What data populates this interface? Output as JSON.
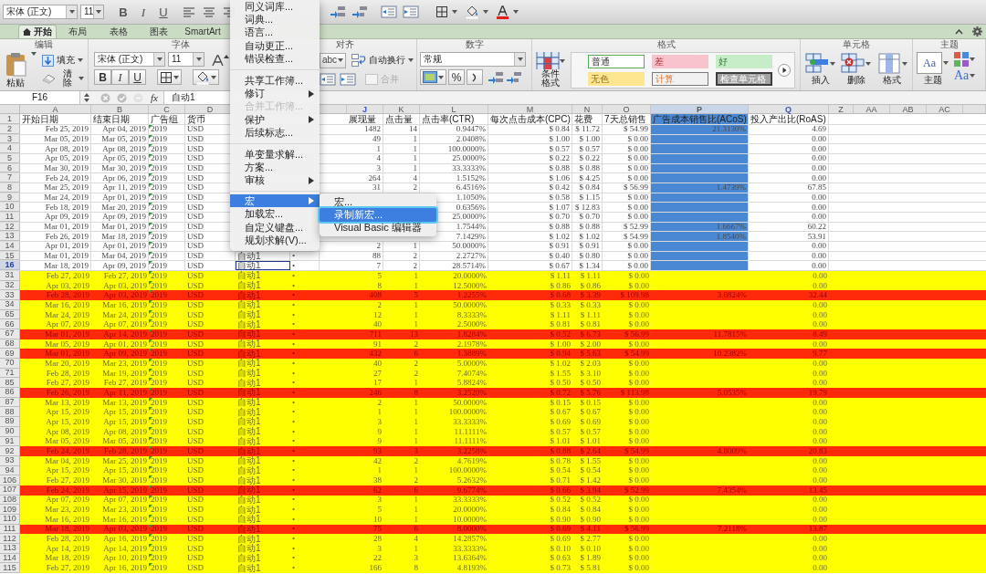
{
  "toolbar": {
    "font": "宋体 (正文)",
    "size": "11",
    "format_buttons": [
      "B",
      "I",
      "U"
    ]
  },
  "ribbon": {
    "tabs": [
      {
        "label": "开始",
        "selected": true
      },
      {
        "label": "布局",
        "selected": false
      },
      {
        "label": "表格",
        "selected": false
      },
      {
        "label": "图表",
        "selected": false
      },
      {
        "label": "SmartArt",
        "selected": false
      }
    ],
    "groups": [
      {
        "kind": "edit",
        "title": "编辑",
        "paste": "粘贴",
        "fill": "填充",
        "clear": "清除"
      },
      {
        "kind": "font",
        "title": "字体",
        "font": "宋体 (正文)",
        "size": "11",
        "format_buttons": [
          "B",
          "I",
          "U"
        ]
      },
      {
        "kind": "align",
        "title": "对齐",
        "orientation": "abc",
        "wrap": "自动换行",
        "merge": {
          "label": "合并",
          "disabled": true
        }
      },
      {
        "kind": "number",
        "title": "数字",
        "format": "常规",
        "percent": "%"
      },
      {
        "kind": "styles",
        "title": "格式",
        "conditional": "条件格式",
        "styles": [
          {
            "label": "普通",
            "kind": "normal"
          },
          {
            "label": "差",
            "kind": "bad"
          },
          {
            "label": "好",
            "kind": "good"
          },
          {
            "label": "无色",
            "kind": "neutral"
          },
          {
            "label": "计算",
            "kind": "calculation"
          },
          {
            "label": "检查单元格",
            "kind": "check"
          }
        ]
      },
      {
        "kind": "cells",
        "title": "单元格",
        "buttons": [
          "插入",
          "删除",
          "格式"
        ]
      },
      {
        "kind": "themes",
        "title": "主题",
        "themes": "主题",
        "preview": "Aa",
        "fonts": "Aa"
      }
    ]
  },
  "formula_bar": {
    "cell": "F16",
    "function": "fx",
    "value": "自动1"
  },
  "sheet": {
    "columns": [
      {
        "letter": "A",
        "selected": false
      },
      {
        "letter": "B",
        "selected": false
      },
      {
        "letter": "C",
        "selected": false
      },
      {
        "letter": "D",
        "selected": false
      },
      {
        "letter": "J",
        "selected": false,
        "color": "#3a4fc8"
      },
      {
        "letter": "K",
        "selected": false
      },
      {
        "letter": "L",
        "selected": false
      },
      {
        "letter": "M",
        "selected": false
      },
      {
        "letter": "N",
        "selected": false
      },
      {
        "letter": "O",
        "selected": false
      },
      {
        "letter": "P",
        "selected": true
      },
      {
        "letter": "Q",
        "selected": false,
        "color": "#3a4fc8"
      },
      {
        "letter": "Z",
        "selected": false
      },
      {
        "letter": "AA",
        "selected": false
      },
      {
        "letter": "AB",
        "selected": false
      },
      {
        "letter": "AC",
        "selected": false
      }
    ],
    "header": {
      "row": "1",
      "start": "开始日期",
      "end": "结束日期",
      "group": "广告组",
      "currency": "货币",
      "impressions": "展现量",
      "clicks": "点击量",
      "ctr": "点击率(CTR)",
      "cpc": "每次点击成本(CPC)",
      "spend": "花费",
      "sales": "7天总销售",
      "acos": "广告成本销售比(ACoS)",
      "roas": "投入产出比(RoAS)"
    },
    "rows": [
      {
        "row": "2",
        "selected": false,
        "start": "Feb 25, 2019",
        "end": "Apr 04, 2019",
        "group": "2019",
        "currency": "USD",
        "impressions": "1482",
        "clicks": "14",
        "ctr": "0.9447%",
        "cpc": "$ 0.84",
        "spend": "$ 11.72",
        "sales": "$ 54.99",
        "acos": "21.3130%",
        "roas": "4.69"
      },
      {
        "row": "3",
        "selected": false,
        "start": "Mar 05, 2019",
        "end": "Mar 05, 2019",
        "group": "2019",
        "currency": "USD",
        "impressions": "49",
        "clicks": "1",
        "ctr": "2.0408%",
        "cpc": "$ 1.00",
        "spend": "$ 1.00",
        "sales": "$ 0.00",
        "roas": "0.00"
      },
      {
        "row": "4",
        "selected": false,
        "start": "Apr 08, 2019",
        "end": "Apr 08, 2019",
        "group": "2019",
        "currency": "USD",
        "impressions": "1",
        "clicks": "1",
        "ctr": "100.0000%",
        "cpc": "$ 0.57",
        "spend": "$ 0.57",
        "sales": "$ 0.00",
        "roas": "0.00"
      },
      {
        "row": "5",
        "selected": false,
        "start": "Apr 05, 2019",
        "end": "Apr 05, 2019",
        "group": "2019",
        "currency": "USD",
        "impressions": "4",
        "clicks": "1",
        "ctr": "25.0000%",
        "cpc": "$ 0.22",
        "spend": "$ 0.22",
        "sales": "$ 0.00",
        "roas": "0.00"
      },
      {
        "row": "6",
        "selected": false,
        "start": "Mar 30, 2019",
        "end": "Mar 30, 2019",
        "group": "2019",
        "currency": "USD",
        "impressions": "3",
        "clicks": "1",
        "ctr": "33.3333%",
        "cpc": "$ 0.88",
        "spend": "$ 0.88",
        "sales": "$ 0.00",
        "roas": "0.00"
      },
      {
        "row": "7",
        "selected": false,
        "start": "Feb 24, 2019",
        "end": "Apr 06, 2019",
        "group": "2019",
        "currency": "USD",
        "impressions": "264",
        "clicks": "4",
        "ctr": "1.5152%",
        "cpc": "$ 1.06",
        "spend": "$ 4.25",
        "sales": "$ 0.00",
        "roas": "0.00"
      },
      {
        "row": "8",
        "selected": false,
        "start": "Mar 25, 2019",
        "end": "Apr 11, 2019",
        "group": "2019",
        "currency": "USD",
        "impressions": "31",
        "clicks": "2",
        "ctr": "6.4516%",
        "cpc": "$ 0.42",
        "spend": "$ 0.84",
        "sales": "$ 56.99",
        "acos": "1.4739%",
        "roas": "67.85"
      },
      {
        "row": "9",
        "selected": false,
        "start": "Mar 24, 2019",
        "end": "Apr 01, 2019",
        "group": "2019",
        "currency": "USD",
        "ctr": "1.1050%",
        "cpc": "$ 0.58",
        "spend": "$ 1.15",
        "sales": "$ 0.00",
        "roas": "0.00"
      },
      {
        "row": "10",
        "selected": false,
        "start": "Feb 18, 2019",
        "end": "Mar 20, 2019",
        "group": "2019",
        "currency": "USD",
        "ctr": "0.6356%",
        "cpc": "$ 1.07",
        "spend": "$ 12.83",
        "sales": "$ 0.00",
        "roas": "0.00"
      },
      {
        "row": "11",
        "selected": false,
        "start": "Apr 09, 2019",
        "end": "Apr 09, 2019",
        "group": "2019",
        "currency": "USD",
        "ctr": "25.0000%",
        "cpc": "$ 0.70",
        "spend": "$ 0.70",
        "sales": "$ 0.00",
        "roas": "0.00"
      },
      {
        "row": "12",
        "selected": false,
        "start": "Mar 01, 2019",
        "end": "Mar 01, 2019",
        "group": "2019",
        "currency": "USD",
        "ctr": "1.7544%",
        "cpc": "$ 0.88",
        "spend": "$ 0.88",
        "sales": "$ 52.99",
        "acos": "1.6667%",
        "roas": "60.22"
      },
      {
        "row": "13",
        "selected": false,
        "start": "Feb 26, 2019",
        "end": "Mar 18, 2019",
        "group": "2019",
        "currency": "USD",
        "ctr": "7.1429%",
        "cpc": "$ 1.02",
        "spend": "$ 1.02",
        "sales": "$ 54.99",
        "acos": "1.8540%",
        "roas": "53.91"
      },
      {
        "row": "14",
        "selected": false,
        "start": "Apr 01, 2019",
        "end": "Apr 01, 2019",
        "group": "2019",
        "currency": "USD",
        "impressions": "2",
        "clicks": "1",
        "ctr": "50.0000%",
        "cpc": "$ 0.91",
        "spend": "$ 0.91",
        "sales": "$ 0.00",
        "roas": "0.00"
      },
      {
        "row": "15",
        "selected": false,
        "start": "Mar 01, 2019",
        "end": "Mar 04, 2019",
        "group": "2019",
        "currency": "USD",
        "match": "自动1",
        "bullet": "•",
        "impressions": "88",
        "clicks": "2",
        "ctr": "2.2727%",
        "cpc": "$ 0.40",
        "spend": "$ 0.80",
        "sales": "$ 0.00",
        "roas": "0.00"
      },
      {
        "row": "16",
        "selected": true,
        "start": "Mar 18, 2019",
        "end": "Apr 09, 2019",
        "group": "2019",
        "currency": "USD",
        "match": "自动1",
        "bullet": "•",
        "impressions": "7",
        "clicks": "2",
        "ctr": "28.5714%",
        "cpc": "$ 0.67",
        "spend": "$ 1.34",
        "sales": "$ 0.00",
        "roas": "0.00"
      },
      {
        "row": "31",
        "selected": false,
        "color": "#ffff00",
        "start": "Feb 27, 2019",
        "end": "Feb 27, 2019",
        "group": "2019",
        "currency": "USD",
        "match": "自动1",
        "bullet": "•",
        "impressions": "5",
        "clicks": "1",
        "ctr": "20.0000%",
        "cpc": "$ 1.11",
        "spend": "$ 1.11",
        "sales": "$ 0.00",
        "roas": "0.00"
      },
      {
        "row": "32",
        "selected": false,
        "color": "#ffff00",
        "start": "Apr 03, 2019",
        "end": "Apr 03, 2019",
        "group": "2019",
        "currency": "USD",
        "match": "自动1",
        "bullet": "•",
        "impressions": "8",
        "clicks": "1",
        "ctr": "12.5000%",
        "cpc": "$ 0.86",
        "spend": "$ 0.86",
        "sales": "$ 0.00",
        "roas": "0.00"
      },
      {
        "row": "33",
        "selected": false,
        "color": "#ff2a0a",
        "start": "Feb 28, 2019",
        "end": "Apr 03, 2019",
        "group": "2019",
        "currency": "USD",
        "match": "自动1",
        "bullet": "•",
        "impressions": "408",
        "clicks": "5",
        "ctr": "1.2255%",
        "cpc": "$ 0.68",
        "spend": "$ 3.39",
        "sales": "$ 109.98",
        "acos": "3.0824%",
        "roas": "32.44"
      },
      {
        "row": "34",
        "selected": false,
        "color": "#ffff00",
        "start": "Mar 16, 2019",
        "end": "Mar 16, 2019",
        "group": "2019",
        "currency": "USD",
        "match": "自动1",
        "bullet": "•",
        "impressions": "2",
        "clicks": "1",
        "ctr": "50.0000%",
        "cpc": "$ 0.33",
        "spend": "$ 0.33",
        "sales": "$ 0.00",
        "roas": "0.00"
      },
      {
        "row": "65",
        "selected": false,
        "color": "#ffff00",
        "start": "Mar 24, 2019",
        "end": "Mar 24, 2019",
        "group": "2019",
        "currency": "USD",
        "match": "自动1",
        "bullet": "•",
        "impressions": "12",
        "clicks": "1",
        "ctr": "8.3333%",
        "cpc": "$ 1.11",
        "spend": "$ 1.11",
        "sales": "$ 0.00",
        "roas": "0.00"
      },
      {
        "row": "66",
        "selected": false,
        "color": "#ffff00",
        "start": "Apr 07, 2019",
        "end": "Apr 07, 2019",
        "group": "2019",
        "currency": "USD",
        "match": "自动1",
        "bullet": "•",
        "impressions": "40",
        "clicks": "1",
        "ctr": "2.5000%",
        "cpc": "$ 0.81",
        "spend": "$ 0.81",
        "sales": "$ 0.00",
        "roas": "0.00"
      },
      {
        "row": "67",
        "selected": false,
        "color": "#ff2a0a",
        "start": "Mar 01, 2019",
        "end": "Apr 14, 2019",
        "group": "2019",
        "currency": "USD",
        "match": "自动1",
        "bullet": "•",
        "impressions": "711",
        "clicks": "13",
        "ctr": "1.8284%",
        "cpc": "$ 0.52",
        "spend": "$ 6.73",
        "sales": "$ 56.99",
        "acos": "11.7815%",
        "roas": "8.49"
      },
      {
        "row": "68",
        "selected": false,
        "color": "#ffff00",
        "start": "Mar 05, 2019",
        "end": "Apr 01, 2019",
        "group": "2019",
        "currency": "USD",
        "match": "自动1",
        "bullet": "•",
        "impressions": "91",
        "clicks": "2",
        "ctr": "2.1978%",
        "cpc": "$ 1.00",
        "spend": "$ 2.00",
        "sales": "$ 0.00",
        "roas": "0.00"
      },
      {
        "row": "69",
        "selected": false,
        "color": "#ff2a0a",
        "start": "Mar 01, 2019",
        "end": "Apr 09, 2019",
        "group": "2019",
        "currency": "USD",
        "match": "自动1",
        "bullet": "•",
        "impressions": "432",
        "clicks": "6",
        "ctr": "1.3889%",
        "cpc": "$ 0.94",
        "spend": "$ 5.63",
        "sales": "$ 54.99",
        "acos": "10.2382%",
        "roas": "9.77"
      },
      {
        "row": "70",
        "selected": false,
        "color": "#ffff00",
        "start": "Mar 20, 2019",
        "end": "Mar 23, 2019",
        "group": "2019",
        "currency": "USD",
        "match": "自动1",
        "bullet": "•",
        "impressions": "40",
        "clicks": "2",
        "ctr": "5.0000%",
        "cpc": "$ 1.02",
        "spend": "$ 2.03",
        "sales": "$ 0.00",
        "roas": "0.00"
      },
      {
        "row": "71",
        "selected": false,
        "color": "#ffff00",
        "start": "Feb 28, 2019",
        "end": "Mar 19, 2019",
        "group": "2019",
        "currency": "USD",
        "match": "自动1",
        "bullet": "•",
        "impressions": "27",
        "clicks": "2",
        "ctr": "7.4074%",
        "cpc": "$ 1.55",
        "spend": "$ 3.10",
        "sales": "$ 0.00",
        "roas": "0.00"
      },
      {
        "row": "85",
        "selected": false,
        "color": "#ffff00",
        "start": "Feb 27, 2019",
        "end": "Feb 27, 2019",
        "group": "2019",
        "currency": "USD",
        "match": "自动1",
        "bullet": "•",
        "impressions": "17",
        "clicks": "1",
        "ctr": "5.8824%",
        "cpc": "$ 0.50",
        "spend": "$ 0.50",
        "sales": "$ 0.00",
        "roas": "0.00"
      },
      {
        "row": "86",
        "selected": false,
        "color": "#ff2a0a",
        "start": "Feb 26, 2019",
        "end": "Apr 11, 2019",
        "group": "2019",
        "currency": "USD",
        "match": "自动1",
        "bullet": "•",
        "impressions": "246",
        "clicks": "8",
        "ctr": "3.2520%",
        "cpc": "$ 0.72",
        "spend": "$ 5.76",
        "sales": "$ 113.98",
        "acos": "5.0535%",
        "roas": "19.79"
      },
      {
        "row": "87",
        "selected": false,
        "color": "#ffff00",
        "start": "Mar 13, 2019",
        "end": "Mar 13, 2019",
        "group": "2019",
        "currency": "USD",
        "match": "自动1",
        "bullet": "•",
        "impressions": "2",
        "clicks": "1",
        "ctr": "50.0000%",
        "cpc": "$ 0.15",
        "spend": "$ 0.15",
        "sales": "$ 0.00",
        "roas": "0.00"
      },
      {
        "row": "88",
        "selected": false,
        "color": "#ffff00",
        "start": "Apr 15, 2019",
        "end": "Apr 15, 2019",
        "group": "2019",
        "currency": "USD",
        "match": "自动1",
        "bullet": "•",
        "impressions": "1",
        "clicks": "1",
        "ctr": "100.0000%",
        "cpc": "$ 0.67",
        "spend": "$ 0.67",
        "sales": "$ 0.00",
        "roas": "0.00"
      },
      {
        "row": "89",
        "selected": false,
        "color": "#ffff00",
        "start": "Apr 15, 2019",
        "end": "Apr 15, 2019",
        "group": "2019",
        "currency": "USD",
        "match": "自动1",
        "bullet": "•",
        "impressions": "3",
        "clicks": "1",
        "ctr": "33.3333%",
        "cpc": "$ 0.69",
        "spend": "$ 0.69",
        "sales": "$ 0.00",
        "roas": "0.00"
      },
      {
        "row": "90",
        "selected": false,
        "color": "#ffff00",
        "start": "Apr 08, 2019",
        "end": "Apr 08, 2019",
        "group": "2019",
        "currency": "USD",
        "match": "自动1",
        "bullet": "•",
        "impressions": "9",
        "clicks": "1",
        "ctr": "11.1111%",
        "cpc": "$ 0.57",
        "spend": "$ 0.57",
        "sales": "$ 0.00",
        "roas": "0.00"
      },
      {
        "row": "91",
        "selected": false,
        "color": "#ffff00",
        "start": "Mar 05, 2019",
        "end": "Mar 05, 2019",
        "group": "2019",
        "currency": "USD",
        "match": "自动1",
        "bullet": "•",
        "impressions": "9",
        "clicks": "1",
        "ctr": "11.1111%",
        "cpc": "$ 1.01",
        "spend": "$ 1.01",
        "sales": "$ 0.00",
        "roas": "0.00"
      },
      {
        "row": "92",
        "selected": false,
        "color": "#ff2a0a",
        "start": "Feb 24, 2019",
        "end": "Feb 28, 2019",
        "group": "2019",
        "currency": "USD",
        "match": "自动1",
        "bullet": "•",
        "impressions": "93",
        "clicks": "3",
        "ctr": "3.2258%",
        "cpc": "$ 0.88",
        "spend": "$ 2.64",
        "sales": "$ 54.99",
        "acos": "4.8009%",
        "roas": "20.83"
      },
      {
        "row": "93",
        "selected": false,
        "color": "#ffff00",
        "start": "Mar 04, 2019",
        "end": "Mar 25, 2019",
        "group": "2019",
        "currency": "USD",
        "match": "自动1",
        "bullet": "•",
        "impressions": "42",
        "clicks": "2",
        "ctr": "4.7619%",
        "cpc": "$ 0.78",
        "spend": "$ 1.55",
        "sales": "$ 0.00",
        "roas": "0.00"
      },
      {
        "row": "94",
        "selected": false,
        "color": "#ffff00",
        "start": "Apr 15, 2019",
        "end": "Apr 15, 2019",
        "group": "2019",
        "currency": "USD",
        "match": "自动1",
        "bullet": "•",
        "impressions": "1",
        "clicks": "1",
        "ctr": "100.0000%",
        "cpc": "$ 0.54",
        "spend": "$ 0.54",
        "sales": "$ 0.00",
        "roas": "0.00"
      },
      {
        "row": "106",
        "selected": false,
        "color": "#ffff00",
        "start": "Feb 27, 2019",
        "end": "Mar 30, 2019",
        "group": "2019",
        "currency": "USD",
        "match": "自动1",
        "bullet": "•",
        "impressions": "38",
        "clicks": "2",
        "ctr": "5.2632%",
        "cpc": "$ 0.71",
        "spend": "$ 1.42",
        "sales": "$ 0.00",
        "roas": "0.00"
      },
      {
        "row": "107",
        "selected": false,
        "color": "#ff2a0a",
        "start": "Feb 24, 2019",
        "end": "Apr 15, 2019",
        "group": "2019",
        "currency": "USD",
        "match": "自动1",
        "bullet": "•",
        "impressions": "62",
        "clicks": "6",
        "ctr": "9.6774%",
        "cpc": "$ 0.66",
        "spend": "$ 3.94",
        "sales": "$ 52.99",
        "acos": "7.4354%",
        "roas": "13.45"
      },
      {
        "row": "108",
        "selected": false,
        "color": "#ffff00",
        "start": "Apr 07, 2019",
        "end": "Apr 07, 2019",
        "group": "2019",
        "currency": "USD",
        "match": "自动1",
        "bullet": "•",
        "impressions": "3",
        "clicks": "1",
        "ctr": "33.3333%",
        "cpc": "$ 0.52",
        "spend": "$ 0.52",
        "sales": "$ 0.00",
        "roas": "0.00"
      },
      {
        "row": "109",
        "selected": false,
        "color": "#ffff00",
        "start": "Mar 23, 2019",
        "end": "Mar 23, 2019",
        "group": "2019",
        "currency": "USD",
        "match": "自动1",
        "bullet": "•",
        "impressions": "5",
        "clicks": "1",
        "ctr": "20.0000%",
        "cpc": "$ 0.84",
        "spend": "$ 0.84",
        "sales": "$ 0.00",
        "roas": "0.00"
      },
      {
        "row": "110",
        "selected": false,
        "color": "#ffff00",
        "start": "Mar 16, 2019",
        "end": "Mar 16, 2019",
        "group": "2019",
        "currency": "USD",
        "match": "自动1",
        "bullet": "•",
        "impressions": "10",
        "clicks": "1",
        "ctr": "10.0000%",
        "cpc": "$ 0.90",
        "spend": "$ 0.90",
        "sales": "$ 0.00",
        "roas": "0.00"
      },
      {
        "row": "111",
        "selected": false,
        "color": "#ff2a0a",
        "start": "Mar 18, 2019",
        "end": "Apr 03, 2019",
        "group": "2019",
        "currency": "USD",
        "match": "自动1",
        "bullet": "•",
        "impressions": "75",
        "clicks": "6",
        "ctr": "8.0000%",
        "cpc": "$ 0.69",
        "spend": "$ 4.11",
        "sales": "$ 56.99",
        "acos": "7.2118%",
        "roas": "13.87"
      },
      {
        "row": "112",
        "selected": false,
        "color": "#ffff00",
        "start": "Feb 28, 2019",
        "end": "Apr 16, 2019",
        "group": "2019",
        "currency": "USD",
        "match": "自动1",
        "bullet": "•",
        "impressions": "28",
        "clicks": "4",
        "ctr": "14.2857%",
        "cpc": "$ 0.69",
        "spend": "$ 2.77",
        "sales": "$ 0.00",
        "roas": "0.00"
      },
      {
        "row": "113",
        "selected": false,
        "color": "#ffff00",
        "start": "Apr 14, 2019",
        "end": "Apr 14, 2019",
        "group": "2019",
        "currency": "USD",
        "match": "自动1",
        "bullet": "•",
        "impressions": "3",
        "clicks": "1",
        "ctr": "33.3333%",
        "cpc": "$ 0.10",
        "spend": "$ 0.10",
        "sales": "$ 0.00",
        "roas": "0.00"
      },
      {
        "row": "114",
        "selected": false,
        "color": "#ffff00",
        "start": "Mar 18, 2019",
        "end": "Apr 10, 2019",
        "group": "2019",
        "currency": "USD",
        "match": "自动1",
        "bullet": "•",
        "impressions": "22",
        "clicks": "3",
        "ctr": "13.6364%",
        "cpc": "$ 0.63",
        "spend": "$ 1.89",
        "sales": "$ 0.00",
        "roas": "0.00"
      },
      {
        "row": "115",
        "selected": false,
        "color": "#ffff00",
        "start": "Feb 27, 2019",
        "end": "Apr 16, 2019",
        "group": "2019",
        "currency": "USD",
        "match": "自动1",
        "bullet": "•",
        "impressions": "166",
        "clicks": "8",
        "ctr": "4.8193%",
        "cpc": "$ 0.73",
        "spend": "$ 5.81",
        "sales": "$ 0.00",
        "roas": "0.00"
      }
    ]
  },
  "tools_menu": {
    "items": [
      {
        "kind": "item",
        "label": "同义词库...",
        "selected": false,
        "disabled": false,
        "submenu": false
      },
      {
        "kind": "item",
        "label": "词典...",
        "selected": false,
        "disabled": false,
        "submenu": false
      },
      {
        "kind": "item",
        "label": "语言...",
        "selected": false,
        "disabled": false,
        "submenu": false
      },
      {
        "kind": "item",
        "label": "自动更正...",
        "selected": false,
        "disabled": false,
        "submenu": false
      },
      {
        "kind": "item",
        "label": "错误检查...",
        "selected": false,
        "disabled": false,
        "submenu": false
      },
      {
        "kind": "separator"
      },
      {
        "kind": "item",
        "label": "共享工作簿...",
        "selected": false,
        "disabled": false,
        "submenu": false
      },
      {
        "kind": "item",
        "label": "修订",
        "selected": false,
        "disabled": false,
        "submenu": true
      },
      {
        "kind": "item",
        "label": "合并工作簿...",
        "selected": false,
        "disabled": true,
        "submenu": false
      },
      {
        "kind": "item",
        "label": "保护",
        "selected": false,
        "disabled": false,
        "submenu": true
      },
      {
        "kind": "item",
        "label": "后续标志...",
        "selected": false,
        "disabled": false,
        "submenu": false
      },
      {
        "kind": "separator"
      },
      {
        "kind": "item",
        "label": "单变量求解...",
        "selected": false,
        "disabled": false,
        "submenu": false
      },
      {
        "kind": "item",
        "label": "方案...",
        "selected": false,
        "disabled": false,
        "submenu": false
      },
      {
        "kind": "item",
        "label": "审核",
        "selected": false,
        "disabled": false,
        "submenu": true
      },
      {
        "kind": "separator"
      },
      {
        "kind": "item",
        "label": "宏",
        "selected": true,
        "disabled": false,
        "submenu": true
      },
      {
        "kind": "item",
        "label": "加载宏...",
        "selected": false,
        "disabled": false,
        "submenu": false
      },
      {
        "kind": "item",
        "label": "自定义键盘...",
        "selected": false,
        "disabled": false,
        "submenu": false
      },
      {
        "kind": "item",
        "label": "规划求解(V)...",
        "selected": false,
        "disabled": false,
        "submenu": false
      }
    ]
  },
  "macro_submenu": {
    "items": [
      {
        "label": "宏...",
        "selected": false
      },
      {
        "label": "录制新宏...",
        "selected": true
      },
      {
        "label": "Visual Basic 编辑器",
        "selected": false
      }
    ]
  }
}
